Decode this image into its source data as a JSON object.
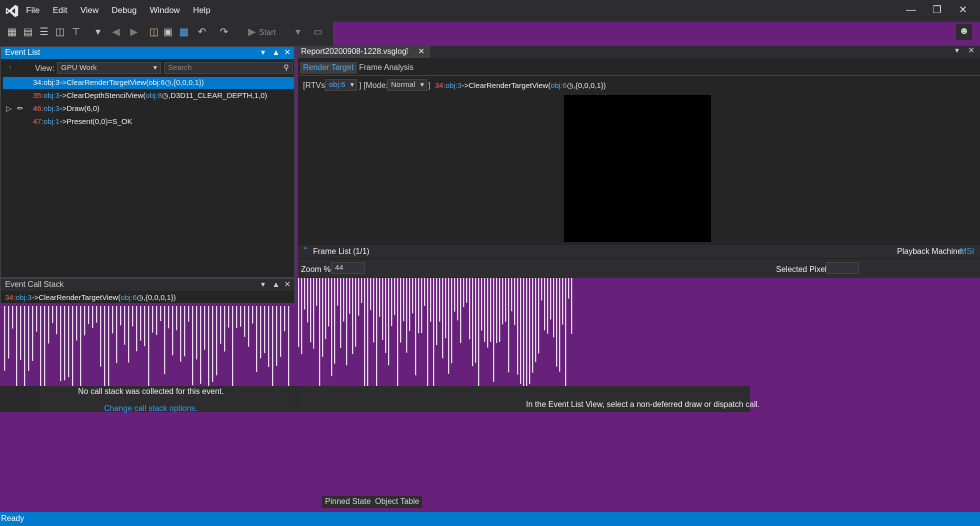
{
  "menu": [
    "File",
    "Edit",
    "View",
    "Debug",
    "Window",
    "Help"
  ],
  "toolbar": {
    "start_label": "Start"
  },
  "event_list": {
    "title": "Event List",
    "view_label": "View:",
    "view_value": "GPU Work",
    "search_placeholder": "Search",
    "rows": [
      {
        "num": "34:",
        "obj": "obj:3",
        "call": "->ClearRenderTargetView(",
        "arg": "obj:6",
        "rest": ",{0,0,0,1})"
      },
      {
        "num": "35:",
        "obj": "obj:3",
        "call": "->ClearDepthStencilView(",
        "arg": "obj:8",
        "rest": ",D3D11_CLEAR_DEPTH,1,0)"
      },
      {
        "num": "46:",
        "obj": "obj:3",
        "call": "->Draw(6,0)",
        "arg": "",
        "rest": ""
      },
      {
        "num": "47:",
        "obj": "obj:1",
        "call": "->Present(0,0)=S_OK",
        "arg": "",
        "rest": ""
      }
    ]
  },
  "call_stack": {
    "title": "Event Call Stack",
    "row": {
      "num": "34:",
      "obj": "obj:3",
      "call": "->ClearRenderTargetView(",
      "arg": "obj:6",
      "rest": ",{0,0,0,1})"
    },
    "empty_message": "No call stack was collected for this event.",
    "options_link": "Change call stack options."
  },
  "document": {
    "tab_title": "Report20200908-1228.vsglog",
    "tabs": [
      "Render Target",
      "Frame Analysis"
    ],
    "rtvs_label": "[RTVs:",
    "rtvs_value": "obj:6",
    "mode_label": "] [Mode:",
    "mode_value": "Normal",
    "mode_close": "]",
    "event_num": "34:",
    "event_obj": "obj:3",
    "event_call": "->ClearRenderTargetView(",
    "event_arg": "obj:6",
    "event_rest": ",{0,0,0,1})",
    "frame_list_label": "Frame List (1/1)",
    "playback_label": "Playback Machine:",
    "playback_value": "MSI",
    "zoom_label": "Zoom %",
    "zoom_value": "44",
    "selected_pixel_label": "Selected Pixel"
  },
  "hint_message": "In the Event List View, select a non-deferred draw or dispatch call.",
  "bottom_tabs": [
    "Pinned State",
    "Object Table"
  ],
  "status": {
    "text": "Ready"
  },
  "colors": {
    "accent": "#007acc",
    "background": "#68217a",
    "panel": "#252526",
    "red": "#f06a5a",
    "blue": "#4fa7e6"
  }
}
